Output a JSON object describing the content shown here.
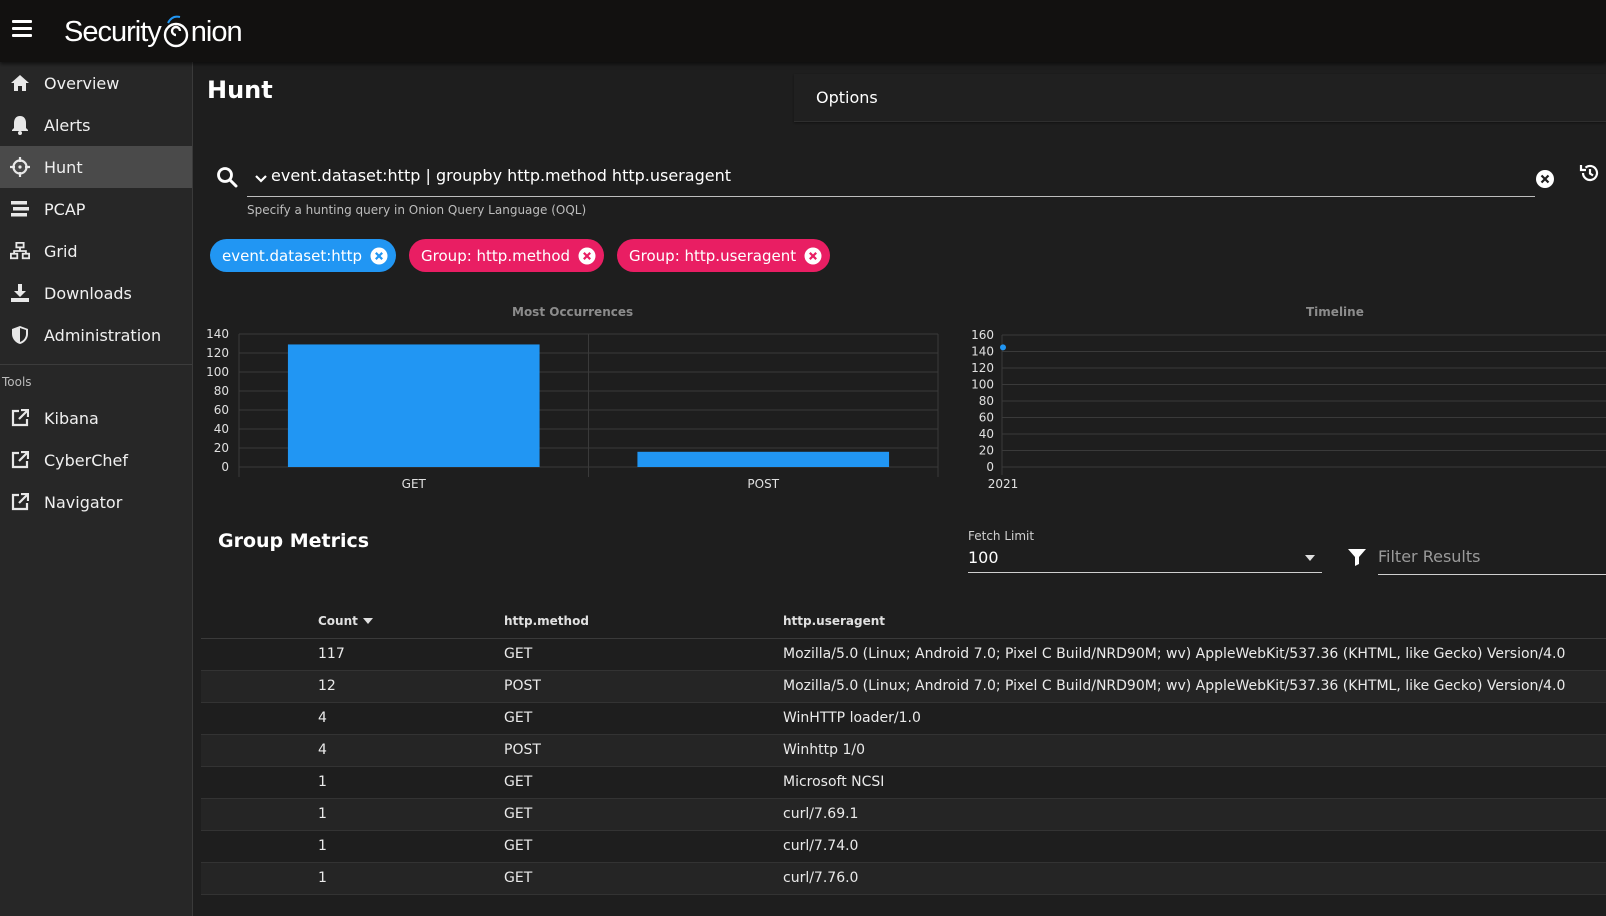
{
  "app": {
    "logo_left": "Security",
    "logo_right": "nion"
  },
  "sidebar": {
    "items": [
      {
        "label": "Overview",
        "icon": "home-icon"
      },
      {
        "label": "Alerts",
        "icon": "bell-icon"
      },
      {
        "label": "Hunt",
        "icon": "crosshairs-icon",
        "active": true
      },
      {
        "label": "PCAP",
        "icon": "stream-icon"
      },
      {
        "label": "Grid",
        "icon": "sitemap-icon"
      },
      {
        "label": "Downloads",
        "icon": "download-icon"
      },
      {
        "label": "Administration",
        "icon": "shield-icon"
      }
    ],
    "tools_label": "Tools",
    "tools": [
      {
        "label": "Kibana",
        "icon": "external-link-icon"
      },
      {
        "label": "CyberChef",
        "icon": "external-link-icon"
      },
      {
        "label": "Navigator",
        "icon": "external-link-icon"
      }
    ]
  },
  "page": {
    "title": "Hunt",
    "options_label": "Options"
  },
  "query": {
    "value": "event.dataset:http | groupby http.method http.useragent",
    "hint": "Specify a hunting query in Onion Query Language (OQL)"
  },
  "chips": [
    {
      "label": "event.dataset:http",
      "color": "#2196f3"
    },
    {
      "label": "Group: http.method",
      "color": "#e91e63"
    },
    {
      "label": "Group: http.useragent",
      "color": "#e91e63"
    }
  ],
  "chart_data": [
    {
      "type": "bar",
      "title": "Most Occurrences",
      "categories": [
        "GET",
        "POST"
      ],
      "values": [
        129,
        16
      ],
      "ylim": [
        0,
        140
      ],
      "yticks": [
        "140",
        "120",
        "100",
        "80",
        "60",
        "40",
        "20",
        "0"
      ],
      "color": "#2196f3",
      "grid": true
    },
    {
      "type": "scatter",
      "title": "Timeline",
      "x": [
        "2021"
      ],
      "values": [
        145
      ],
      "ylim": [
        0,
        160
      ],
      "yticks": [
        "160",
        "140",
        "120",
        "100",
        "80",
        "60",
        "40",
        "20",
        "0"
      ],
      "color": "#2196f3",
      "grid": true
    }
  ],
  "group_metrics": {
    "title": "Group Metrics",
    "fetch_limit_label": "Fetch Limit",
    "fetch_limit_value": "100",
    "filter_placeholder": "Filter Results",
    "columns": [
      "Count",
      "http.method",
      "http.useragent"
    ],
    "rows": [
      [
        "117",
        "GET",
        "Mozilla/5.0 (Linux; Android 7.0; Pixel C Build/NRD90M; wv) AppleWebKit/537.36 (KHTML, like Gecko) Version/4.0"
      ],
      [
        "12",
        "POST",
        "Mozilla/5.0 (Linux; Android 7.0; Pixel C Build/NRD90M; wv) AppleWebKit/537.36 (KHTML, like Gecko) Version/4.0"
      ],
      [
        "4",
        "GET",
        "WinHTTP loader/1.0"
      ],
      [
        "4",
        "POST",
        "Winhttp 1/0"
      ],
      [
        "1",
        "GET",
        "Microsoft NCSI"
      ],
      [
        "1",
        "GET",
        "curl/7.69.1"
      ],
      [
        "1",
        "GET",
        "curl/7.74.0"
      ],
      [
        "1",
        "GET",
        "curl/7.76.0"
      ]
    ]
  }
}
